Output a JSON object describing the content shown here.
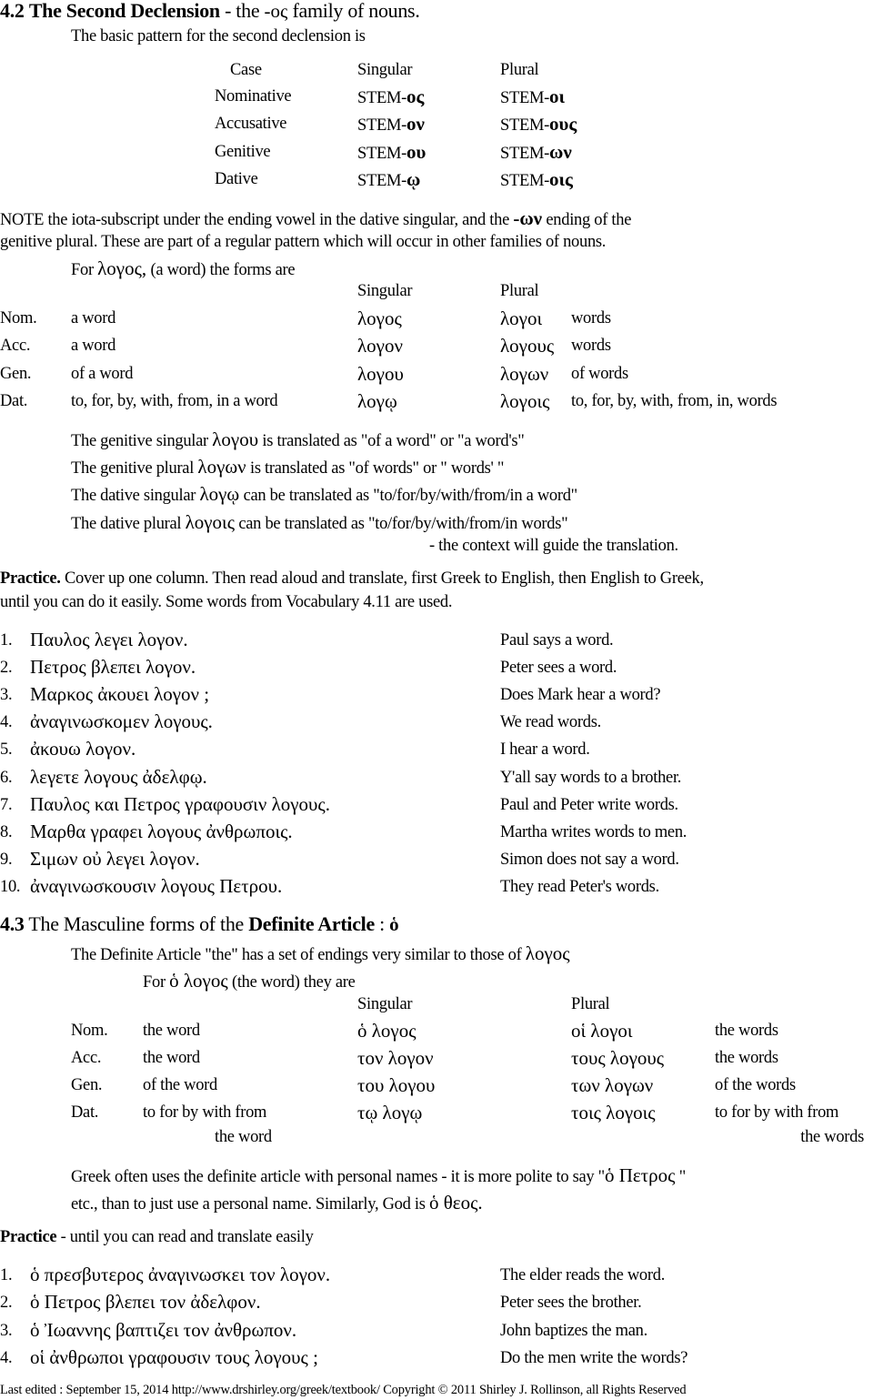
{
  "s42": {
    "num": "4.2",
    "title": "The Second Declension",
    "title_rest": " - the ",
    "os": "-ος",
    "title_tail": " family of nouns.",
    "intro": "The basic pattern for  the second declension is",
    "pattern": {
      "headers": [
        "Case",
        "Singular",
        "Plural"
      ],
      "rows": [
        [
          "Nominative",
          "STEM-",
          "ος",
          "STEM-",
          "οι"
        ],
        [
          "Accusative",
          "STEM-",
          "ον",
          "STEM-",
          "ους"
        ],
        [
          "Genitive",
          "STEM-",
          "ου",
          "STEM-",
          "ων"
        ],
        [
          "Dative",
          "STEM-",
          "ῳ",
          "STEM-",
          "οις"
        ]
      ]
    },
    "note1a": "NOTE   the iota-subscript under the ending vowel in the dative singular,  and the ",
    "note1b": "-ων",
    "note1c": " ending of the",
    "note2": "genitive plural.   These are part of a regular pattern which will occur in other families of nouns.",
    "for_a": "For ",
    "for_g": "λογος,",
    "for_b": " (a word) the forms are",
    "forms_headers": [
      "Singular",
      "Plural"
    ],
    "forms": [
      [
        "Nom.",
        "a word",
        "λογος",
        "λογοι",
        "words"
      ],
      [
        "Acc.",
        "a word",
        "λογον",
        "λογους",
        "words"
      ],
      [
        "Gen.",
        "of a word",
        "λογου",
        "λογων",
        "of words"
      ],
      [
        "Dat.",
        "to, for, by, with, from, in a word",
        "λογῳ",
        "λογοις",
        "to, for, by, with, from, in, words"
      ]
    ],
    "explain": [
      [
        "The genitive singular ",
        "λογου",
        " is translated as \"of a word\" or \"a word's\""
      ],
      [
        "The genitive plural ",
        "λογων",
        " is translated as \"of words\" or \" words' \""
      ],
      [
        "The dative singular ",
        "λογῳ",
        "  can be translated as \"to/for/by/with/from/in a word\""
      ],
      [
        "The dative plural ",
        "λογοις",
        "  can be translated as \"to/for/by/with/from/in words\""
      ]
    ],
    "context": "- the context will guide the translation.",
    "practice_label": "Practice.",
    "practice_1": " Cover up one column. Then read aloud and translate, first Greek to English, then English to Greek,",
    "practice_2": "until you can do it easily.  Some words from Vocabulary 4.11 are used.",
    "exercises": [
      [
        "1.",
        "Παυλος λεγει λογον.",
        "Paul says a word."
      ],
      [
        "2.",
        "Πετρος βλεπει λογον.",
        "Peter sees a word."
      ],
      [
        "3.",
        "Μαρκος ἀκουει λογον ;",
        "Does Mark hear a word?"
      ],
      [
        "4.",
        "ἀναγινωσκομεν λογους.",
        "We read words."
      ],
      [
        "5.",
        "ἀκουω λογον.",
        "I hear a word."
      ],
      [
        "6.",
        "λεγετε λογους ἀδελφῳ.",
        "Y'all say words to a brother."
      ],
      [
        "7.",
        "Παυλος και Πετρος γραφουσιν λογους.",
        "Paul and Peter write words."
      ],
      [
        "8.",
        "Μαρθα γραφει λογους ἀνθρωποις.",
        "Martha writes words to men."
      ],
      [
        "9.",
        "Σιμων οὐ λεγει λογον.",
        "Simon does not say a word."
      ],
      [
        "10.",
        "ἀναγινωσκουσιν λογους Πετρου.",
        "They read Peter's words."
      ]
    ]
  },
  "s43": {
    "num": "4.3",
    "title_a": " The Masculine forms of the ",
    "title_b": "Definite Article",
    "title_c": " :  ",
    "title_g": "ὁ",
    "intro_a": "The Definite Article \"the\" has a set of endings very similar to those of ",
    "intro_g": "λογος",
    "for_a": "For ",
    "for_g": "ὁ λογος",
    "for_b": " (the word) they are",
    "headers": [
      "Singular",
      "Plural"
    ],
    "rows": [
      [
        "Nom.",
        "the word",
        "ὁ  λογος",
        "οἱ  λογοι",
        "the words"
      ],
      [
        "Acc.",
        "the word",
        "τον  λογον",
        "τους  λογους",
        "the words"
      ],
      [
        "Gen.",
        "of the word",
        "του  λογου",
        "των  λογων",
        "of the words"
      ],
      [
        "Dat.",
        "to for by with from",
        "τῳ  λογῳ",
        "τοις  λογοις",
        "to for by with from"
      ]
    ],
    "dat_cont_sg": "the word",
    "dat_cont_pl": "the words",
    "p1a": "Greek often uses the definite article with personal names - it is more polite to say  \"",
    "p1g": "ὁ Πετρος",
    "p1b": " \"",
    "p2a": "etc., than to just use a personal name.    Similarly, God is  ",
    "p2g": "ὁ θεος.",
    "practice_label": "Practice",
    "practice_rest": " - until you can read and translate easily",
    "exercises": [
      [
        "1.",
        "ὁ πρεσβυτερος ἀναγινωσκει τον λογον.",
        "The elder reads the word."
      ],
      [
        "2.",
        "ὁ Πετρος βλεπει τον ἀδελφον.",
        "Peter sees the brother."
      ],
      [
        "3.",
        "ὁ Ἰωαννης βαπτιζει τον ἀνθρωπον.",
        "John baptizes the man."
      ],
      [
        "4.",
        "οἱ ἀνθρωποι γραφουσιν τους λογους ;",
        "Do the men write the words?"
      ]
    ]
  },
  "footer": "Last edited : September 15, 2014   http://www.drshirley.org/greek/textbook/  Copyright © 2011 Shirley J. Rollinson, all Rights Reserved"
}
